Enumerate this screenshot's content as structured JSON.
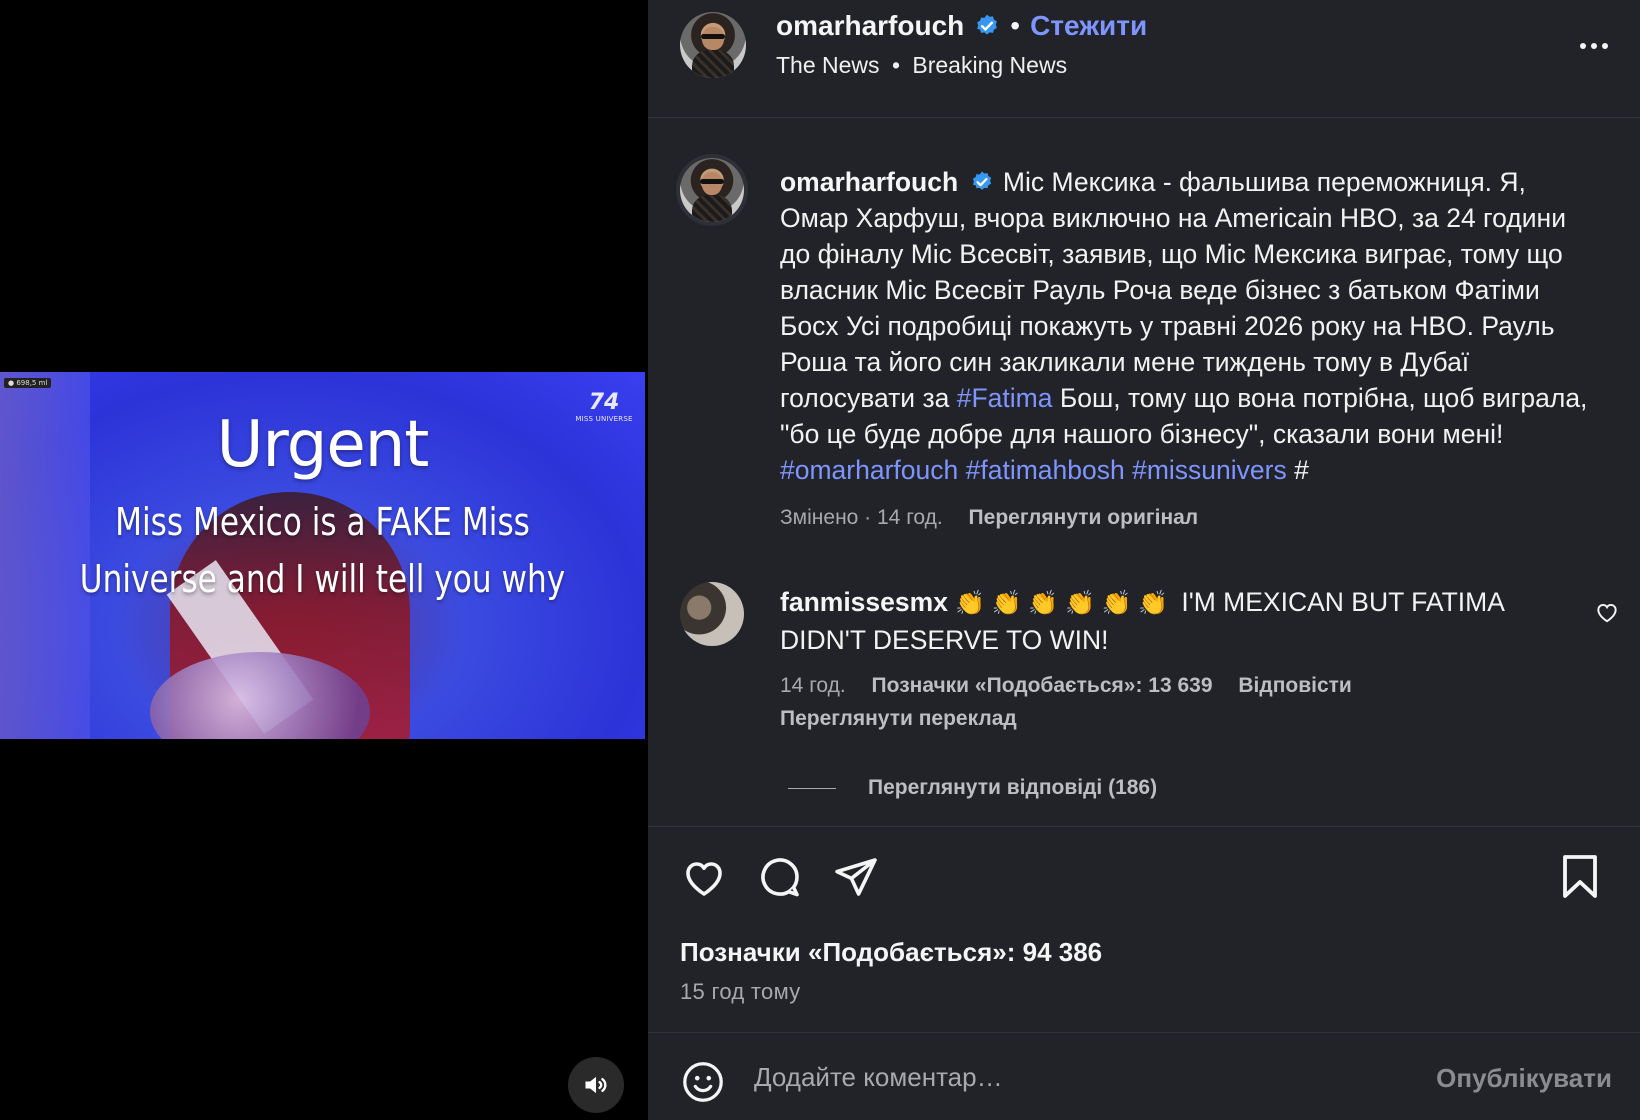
{
  "media": {
    "badge": "● 698,5 ml",
    "watermark_big": "74",
    "watermark_small": "MISS UNIVERSE",
    "title": "Urgent",
    "line1": "Miss Mexico is a FAKE Miss",
    "line2": "Universe and I will tell you why",
    "mute_icon": "speaker-icon"
  },
  "header": {
    "username": "omarharfouch",
    "follow": "Стежити",
    "separator": "•",
    "sub_left": "The News",
    "sub_right": "Breaking News"
  },
  "post": {
    "username": "omarharfouch",
    "text_1": "Міс Мексика - фальшива переможниця. Я, Омар Харфуш, вчора виключно на Americain HBO, за 24 години до фіналу Міс Всесвіт, заявив, що Міс Мексика виграє, тому що власник Міс Всесвіт Рауль Роча веде бізнес з батьком Фатіми Босх Усі подробиці покажуть у травні 2026 року на HBO. Рауль Роша та його син закликали мене тиждень тому в Дубаї голосувати за ",
    "tag_fatima": "#Fatima",
    "text_2": " Бош, тому що вона потрібна, щоб виграла, \"бо це буде добре для нашого бізнесу\", сказали вони мені! ",
    "tag_1": "#omarharfouch",
    "tag_2": "#fatimahbosh",
    "tag_3": "#missunivers",
    "text_3": " #",
    "edited": "Змінено · 14 год.",
    "view_original": "Переглянути оригінал"
  },
  "comment": {
    "username": "fanmissesmx",
    "claps": "👏 👏 👏 👏 👏 👏",
    "text": "I'M MEXICAN BUT FATIMA DIDN'T DESERVE TO WIN!",
    "time": "14 год.",
    "likes": "Позначки «Подобається»: 13 639",
    "reply": "Відповісти",
    "translate": "Переглянути переклад",
    "view_replies": "Переглянути відповіді (186)"
  },
  "footer": {
    "likes": "Позначки «Подобається»: 94 386",
    "time_ago": "15 год тому",
    "comment_placeholder": "Додайте коментар…",
    "publish": "Опублікувати"
  },
  "colors": {
    "accent": "#7e95ff",
    "verified": "#3897f0",
    "panel": "#212328"
  }
}
